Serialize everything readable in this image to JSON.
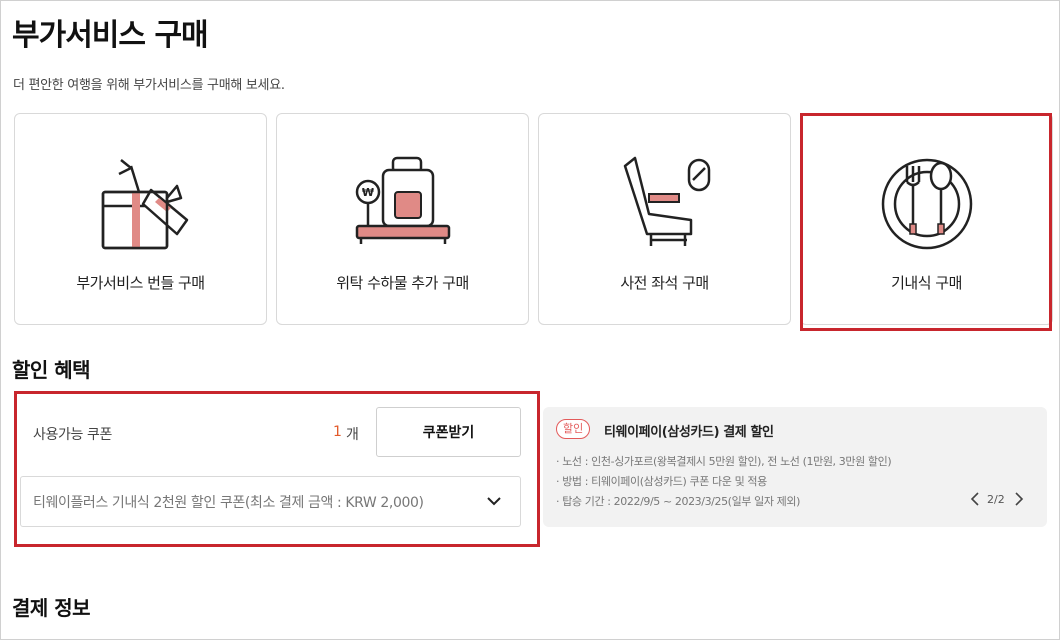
{
  "page": {
    "title": "부가서비스 구매",
    "subtitle": "더 편안한 여행을 위해 부가서비스를 구매해 보세요."
  },
  "services": [
    {
      "label": "부가서비스 번들 구매",
      "icon": "gift-bundle-icon"
    },
    {
      "label": "위탁 수하물 추가 구매",
      "icon": "luggage-icon"
    },
    {
      "label": "사전 좌석 구매",
      "icon": "seat-icon"
    },
    {
      "label": "기내식 구매",
      "icon": "meal-icon",
      "highlighted": true
    }
  ],
  "discount": {
    "section_title": "할인 혜택",
    "coupon_label": "사용가능 쿠폰",
    "coupon_count": "1",
    "coupon_unit": "개",
    "coupon_button": "쿠폰받기",
    "coupon_selected": "티웨이플러스 기내식 2천원 할인 쿠폰(최소 결제 금액 : KRW 2,000)",
    "promo": {
      "badge": "할인",
      "title": "티웨이페이(삼성카드) 결제 할인",
      "lines": [
        "· 노선 : 인천-싱가포르(왕복결제시 5만원 할인), 전 노선 (1만원, 3만원 할인)",
        "· 방법 : 티웨이페이(삼성카드) 쿠폰 다운 및 적용",
        "· 탑승 기간 : 2022/9/5 ~ 2023/3/25(일부 일자 제외)"
      ],
      "pager": "2/2"
    }
  },
  "payment": {
    "section_title": "결제 정보"
  },
  "colors": {
    "accent_red": "#c8262d",
    "salmon": "#e08a86",
    "orange": "#e35a2a"
  }
}
